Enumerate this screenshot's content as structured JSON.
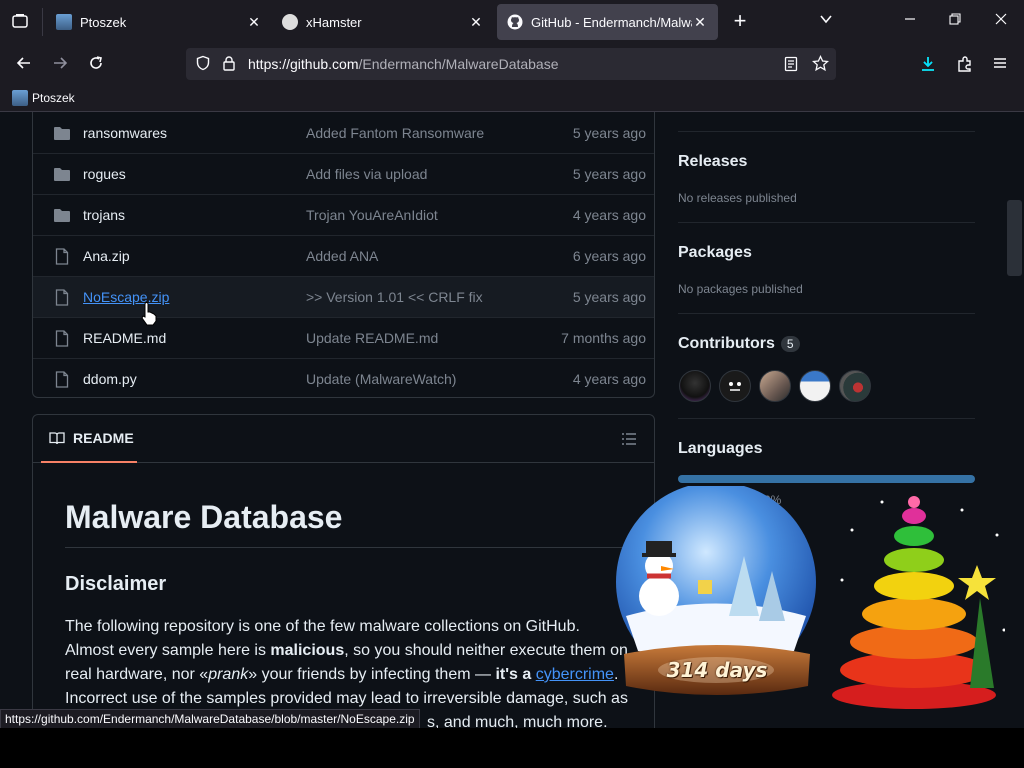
{
  "browser": {
    "tabs": [
      {
        "title": "Ptoszek",
        "close": "✕"
      },
      {
        "title": "xHamster",
        "close": "✕"
      },
      {
        "title": "GitHub - Endermanch/MalwareDatabase",
        "close": "✕"
      }
    ],
    "new_tab": "+",
    "url": "https://github.com/Endermanch/MalwareDatabase",
    "url_host_part": "https://github.com",
    "url_path_part": "/Endermanch/MalwareDatabase",
    "bookmark": "Ptoszek"
  },
  "files": [
    {
      "name": "ransomwares",
      "type": "folder",
      "message": "Added Fantom Ransomware",
      "age": "5 years ago"
    },
    {
      "name": "rogues",
      "type": "folder",
      "message": "Add files via upload",
      "age": "5 years ago"
    },
    {
      "name": "trojans",
      "type": "folder",
      "message": "Trojan YouAreAnIdiot",
      "age": "4 years ago"
    },
    {
      "name": "Ana.zip",
      "type": "file",
      "message": "Added ANA",
      "age": "6 years ago"
    },
    {
      "name": "NoEscape.zip",
      "type": "file",
      "message": ">> Version 1.01 << CRLF fix",
      "age": "5 years ago"
    },
    {
      "name": "README.md",
      "type": "file",
      "message": "Update README.md",
      "age": "7 months ago"
    },
    {
      "name": "ddom.py",
      "type": "file",
      "message": "Update (MalwareWatch)",
      "age": "4 years ago"
    }
  ],
  "readme": {
    "tab_label": "README",
    "h1": "Malware Database",
    "h2": "Disclaimer",
    "p1_a": "The following repository is one of the few malware collections on GitHub.",
    "p1_b": "Almost every sample here is ",
    "p1_bold": "malicious",
    "p1_c": ", so you should neither execute them on",
    "p1_d": "real hardware, nor «",
    "p1_em": "prank",
    "p1_e": "» your friends by infecting them — ",
    "p1_bold2": "it's a ",
    "p1_link": "cybercrime",
    "p1_f": ".",
    "p2_a": "Incorrect use of the samples provided may lead to irreversible damage, such as",
    "p2_b": "s, and much, much more."
  },
  "sidebar": {
    "releases_title": "Releases",
    "releases_text": "No releases published",
    "packages_title": "Packages",
    "packages_text": "No packages published",
    "contributors_title": "Contributors",
    "contributors_count": "5",
    "languages_title": "Languages",
    "languages_partial": "0%"
  },
  "overlay": {
    "days_label": "314 days"
  },
  "status_url": "https://github.com/Endermanch/MalwareDatabase/blob/master/NoEscape.zip",
  "colors": {
    "accent": "#4493f8",
    "bg": "#0d1117",
    "border": "#30363d",
    "muted": "#7d8590",
    "readme_tab_underline": "#f78166",
    "language_bar": "#3572a5"
  }
}
